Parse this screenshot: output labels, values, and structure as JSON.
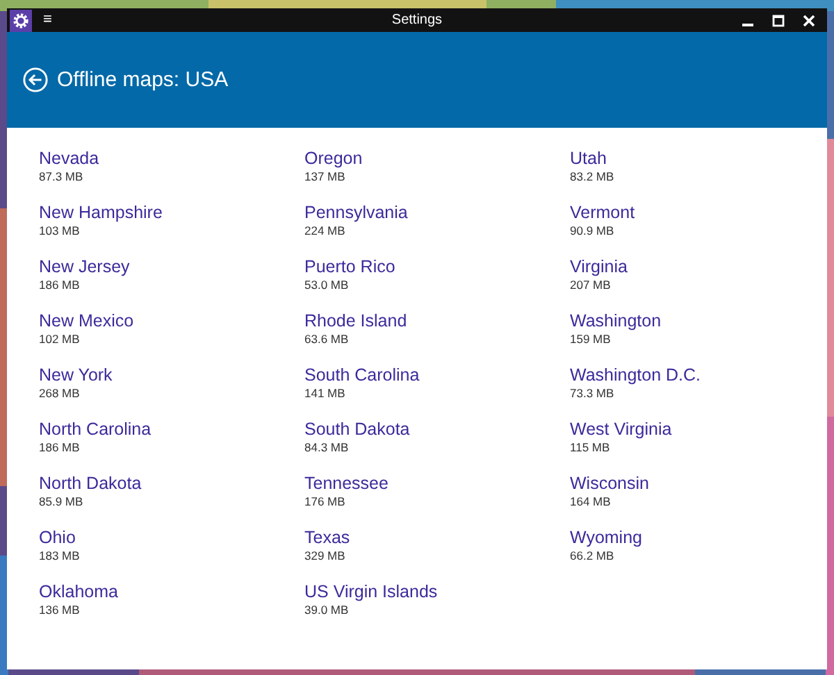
{
  "window": {
    "title": "Settings",
    "menu_glyph": "≡"
  },
  "header": {
    "title": "Offline maps: USA"
  },
  "maps": [
    {
      "name": "Nevada",
      "size": "87.3 MB"
    },
    {
      "name": "New Hampshire",
      "size": "103 MB"
    },
    {
      "name": "New Jersey",
      "size": "186 MB"
    },
    {
      "name": "New Mexico",
      "size": "102 MB"
    },
    {
      "name": "New York",
      "size": "268 MB"
    },
    {
      "name": "North Carolina",
      "size": "186 MB"
    },
    {
      "name": "North Dakota",
      "size": "85.9 MB"
    },
    {
      "name": "Ohio",
      "size": "183 MB"
    },
    {
      "name": "Oklahoma",
      "size": "136 MB"
    },
    {
      "name": "Oregon",
      "size": "137 MB"
    },
    {
      "name": "Pennsylvania",
      "size": "224 MB"
    },
    {
      "name": "Puerto Rico",
      "size": "53.0 MB"
    },
    {
      "name": "Rhode Island",
      "size": "63.6 MB"
    },
    {
      "name": "South Carolina",
      "size": "141 MB"
    },
    {
      "name": "South Dakota",
      "size": "84.3 MB"
    },
    {
      "name": "Tennessee",
      "size": "176 MB"
    },
    {
      "name": "Texas",
      "size": "329 MB"
    },
    {
      "name": "US Virgin Islands",
      "size": "39.0 MB"
    },
    {
      "name": "Utah",
      "size": "83.2 MB"
    },
    {
      "name": "Vermont",
      "size": "90.9 MB"
    },
    {
      "name": "Virginia",
      "size": "207 MB"
    },
    {
      "name": "Washington",
      "size": "159 MB"
    },
    {
      "name": "Washington D.C.",
      "size": "73.3 MB"
    },
    {
      "name": "West Virginia",
      "size": "115 MB"
    },
    {
      "name": "Wisconsin",
      "size": "164 MB"
    },
    {
      "name": "Wyoming",
      "size": "66.2 MB"
    }
  ]
}
